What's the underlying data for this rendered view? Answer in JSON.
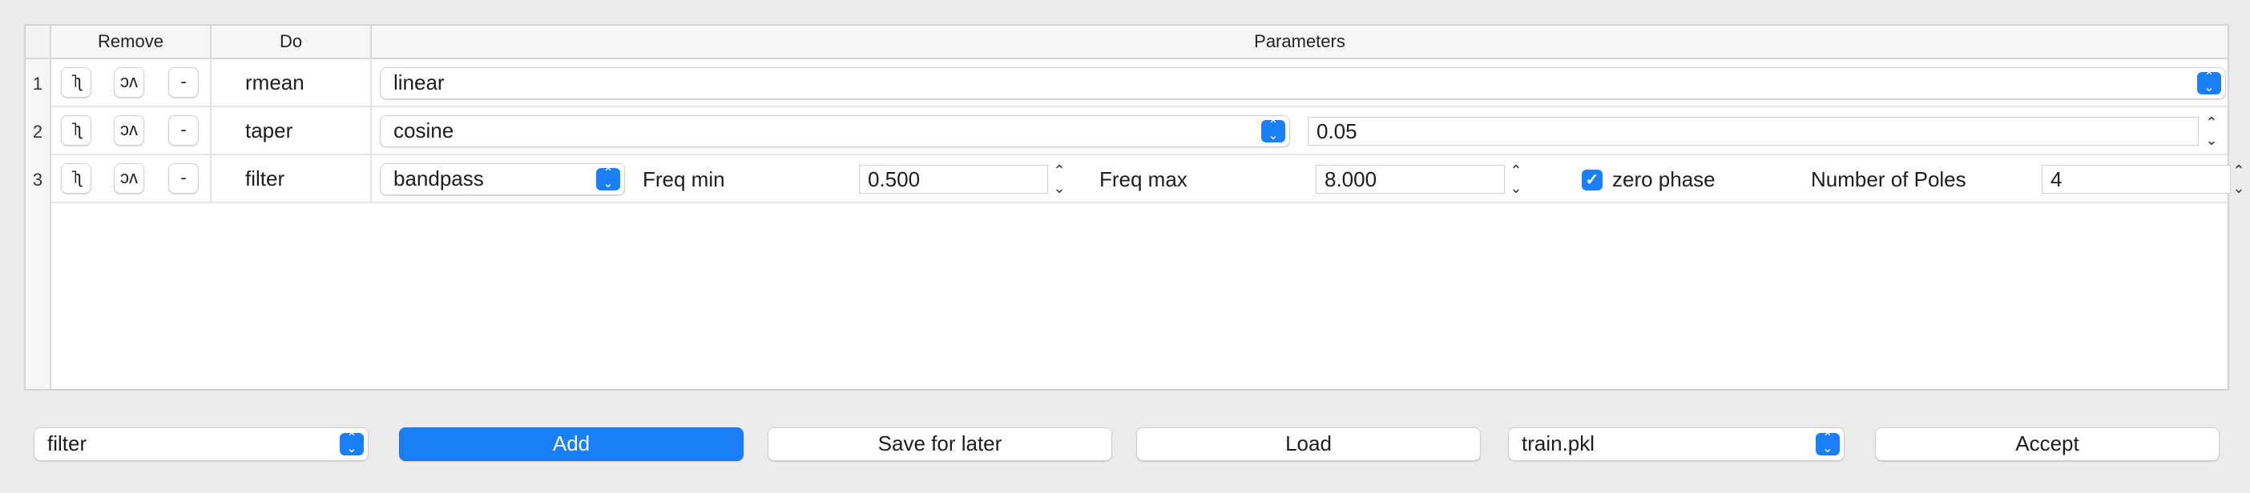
{
  "headers": {
    "remove": "Remove",
    "do": "Do",
    "parameters": "Parameters"
  },
  "row_buttons": {
    "up": "˥ʅ",
    "down": "ɔʌ",
    "remove": "-"
  },
  "rows": [
    {
      "num": "1",
      "do": "rmean",
      "method": "linear"
    },
    {
      "num": "2",
      "do": "taper",
      "type": "cosine",
      "value": "0.05"
    },
    {
      "num": "3",
      "do": "filter",
      "type": "bandpass",
      "freq_min_label": "Freq min",
      "freq_min": "0.500",
      "freq_max_label": "Freq max",
      "freq_max": "8.000",
      "zero_phase_label": "zero phase",
      "zero_phase_checked": true,
      "poles_label": "Number of Poles",
      "poles": "4"
    }
  ],
  "bottom": {
    "operation_select": "filter",
    "add_label": "Add",
    "save_label": "Save for later",
    "load_label": "Load",
    "file_select": "train.pkl",
    "accept_label": "Accept"
  },
  "colors": {
    "accent": "#1a7ff5",
    "background": "#ececec"
  }
}
